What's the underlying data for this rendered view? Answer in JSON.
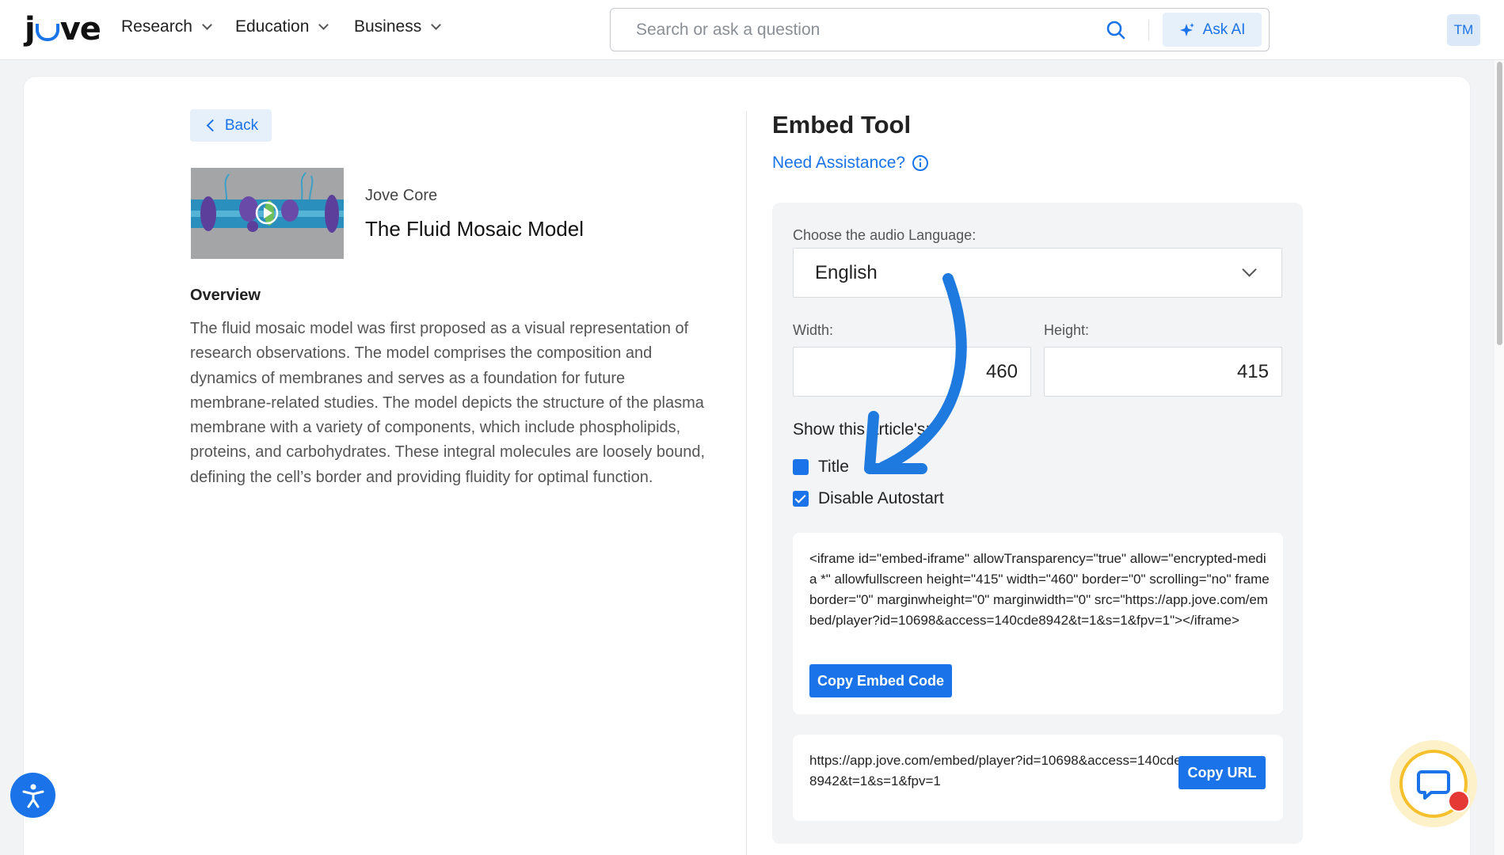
{
  "header": {
    "logo": "jove",
    "nav": [
      {
        "label": "Research"
      },
      {
        "label": "Education"
      },
      {
        "label": "Business"
      }
    ],
    "search_placeholder": "Search or ask a question",
    "ask_ai_label": "Ask AI",
    "avatar_initials": "TM"
  },
  "left": {
    "back_label": "Back",
    "kicker": "Jove Core",
    "video_title": "The Fluid Mosaic Model",
    "overview_heading": "Overview",
    "overview_text": "The fluid mosaic model was first proposed as a visual representation of research observations. The model comprises the composition and dynamics of membranes and serves as a foundation for future membrane-related studies. The model depicts the structure of the plasma membrane with a variety of components, which include phospholipids, proteins, and carbohydrates. These integral molecules are loosely bound, defining the cell’s border and providing fluidity for optimal function."
  },
  "embed": {
    "title": "Embed Tool",
    "assist_label": "Need Assistance?",
    "language_label": "Choose the audio Language:",
    "language_value": "English",
    "width_label": "Width:",
    "width_value": "460",
    "height_label": "Height:",
    "height_value": "415",
    "show_label": "Show this article's:",
    "checkbox_title": "Title",
    "checkbox_title_checked": false,
    "checkbox_autostart": "Disable Autostart",
    "checkbox_autostart_checked": true,
    "embed_code": "<iframe id=\"embed-iframe\" allowTransparency=\"true\" allow=\"encrypted-media *\" allowfullscreen height=\"415\" width=\"460\" border=\"0\" scrolling=\"no\" frameborder=\"0\" marginwheight=\"0\" marginwidth=\"0\" src=\"https://app.jove.com/embed/player?id=10698&access=140cde8942&t=1&s=1&fpv=1\"></iframe>",
    "copy_embed_label": "Copy Embed Code",
    "url": "https://app.jove.com/embed/player?id=10698&access=140cde8942&t=1&s=1&fpv=1",
    "copy_url_label": "Copy URL"
  },
  "colors": {
    "accent": "#1a73e8",
    "annotation_arrow": "#1f7ae0"
  }
}
